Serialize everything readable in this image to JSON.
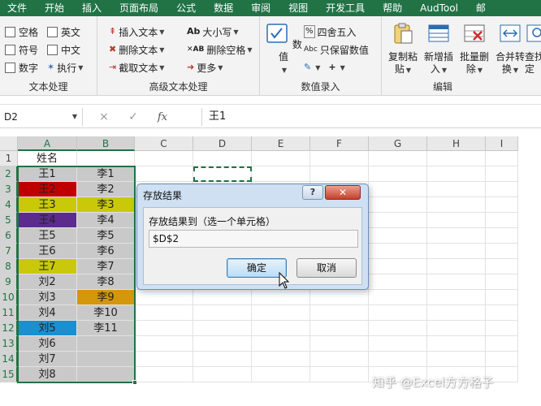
{
  "menu": [
    "文件",
    "开始",
    "插入",
    "页面布局",
    "公式",
    "数据",
    "审阅",
    "视图",
    "开发工具",
    "帮助",
    "AudTool",
    "邮"
  ],
  "ribbon": {
    "text_group": {
      "checks": [
        [
          "空格",
          "英文"
        ],
        [
          "符号",
          "中文"
        ],
        [
          "数字"
        ]
      ],
      "execute": "执行",
      "label": "文本处理"
    },
    "advanced_group": {
      "items": [
        "插入文本",
        "删除文本",
        "截取文本"
      ],
      "items2": [
        "大小写",
        "删除空格",
        "更多"
      ],
      "label": "高级文本处理"
    },
    "entry_group": {
      "value_button": "数值",
      "round": "四舍五入",
      "keep_value": "只保留数值",
      "label": "数值录入"
    },
    "edit_group": {
      "buttons": [
        [
          "复制粘",
          "贴"
        ],
        [
          "新增插",
          "入"
        ],
        [
          "批量删",
          "除"
        ],
        [
          "合并转",
          "换"
        ],
        [
          "查找",
          "定"
        ]
      ],
      "label": "编辑"
    }
  },
  "formula_bar": {
    "name_box": "D2",
    "cancel": "×",
    "enter": "✓",
    "fx": "fx",
    "value": "王1"
  },
  "columns": [
    "A",
    "B",
    "C",
    "D",
    "E",
    "F",
    "G",
    "H",
    "I"
  ],
  "rows": [
    "1",
    "2",
    "3",
    "4",
    "5",
    "6",
    "7",
    "8",
    "9",
    "10",
    "11",
    "12",
    "13",
    "14",
    "15"
  ],
  "colA": [
    "姓名",
    "王1",
    "王2",
    "王3",
    "王4",
    "王5",
    "王6",
    "王7",
    "刘2",
    "刘3",
    "刘4",
    "刘5",
    "刘6",
    "刘7",
    "刘8"
  ],
  "colB": [
    "",
    "李1",
    "李2",
    "李3",
    "李4",
    "李5",
    "李6",
    "李7",
    "李8",
    "李9",
    "李10",
    "李11",
    "",
    "",
    ""
  ],
  "colors": {
    "excel_green": "#217346",
    "red": "#c00000",
    "purple": "#5b2c8e",
    "yellow": "#c9c90a",
    "orange": "#d4960b",
    "blue": "#1b8fd0",
    "gray": "#c9c9c9"
  },
  "dialog": {
    "title": "存放结果",
    "help": "?",
    "close": "✕",
    "prompt": "存放结果到（选一个单元格）",
    "input_value": "$D$2",
    "ok": "确定",
    "cancel": "取消"
  },
  "watermark": "知乎 @Excel方方格子"
}
